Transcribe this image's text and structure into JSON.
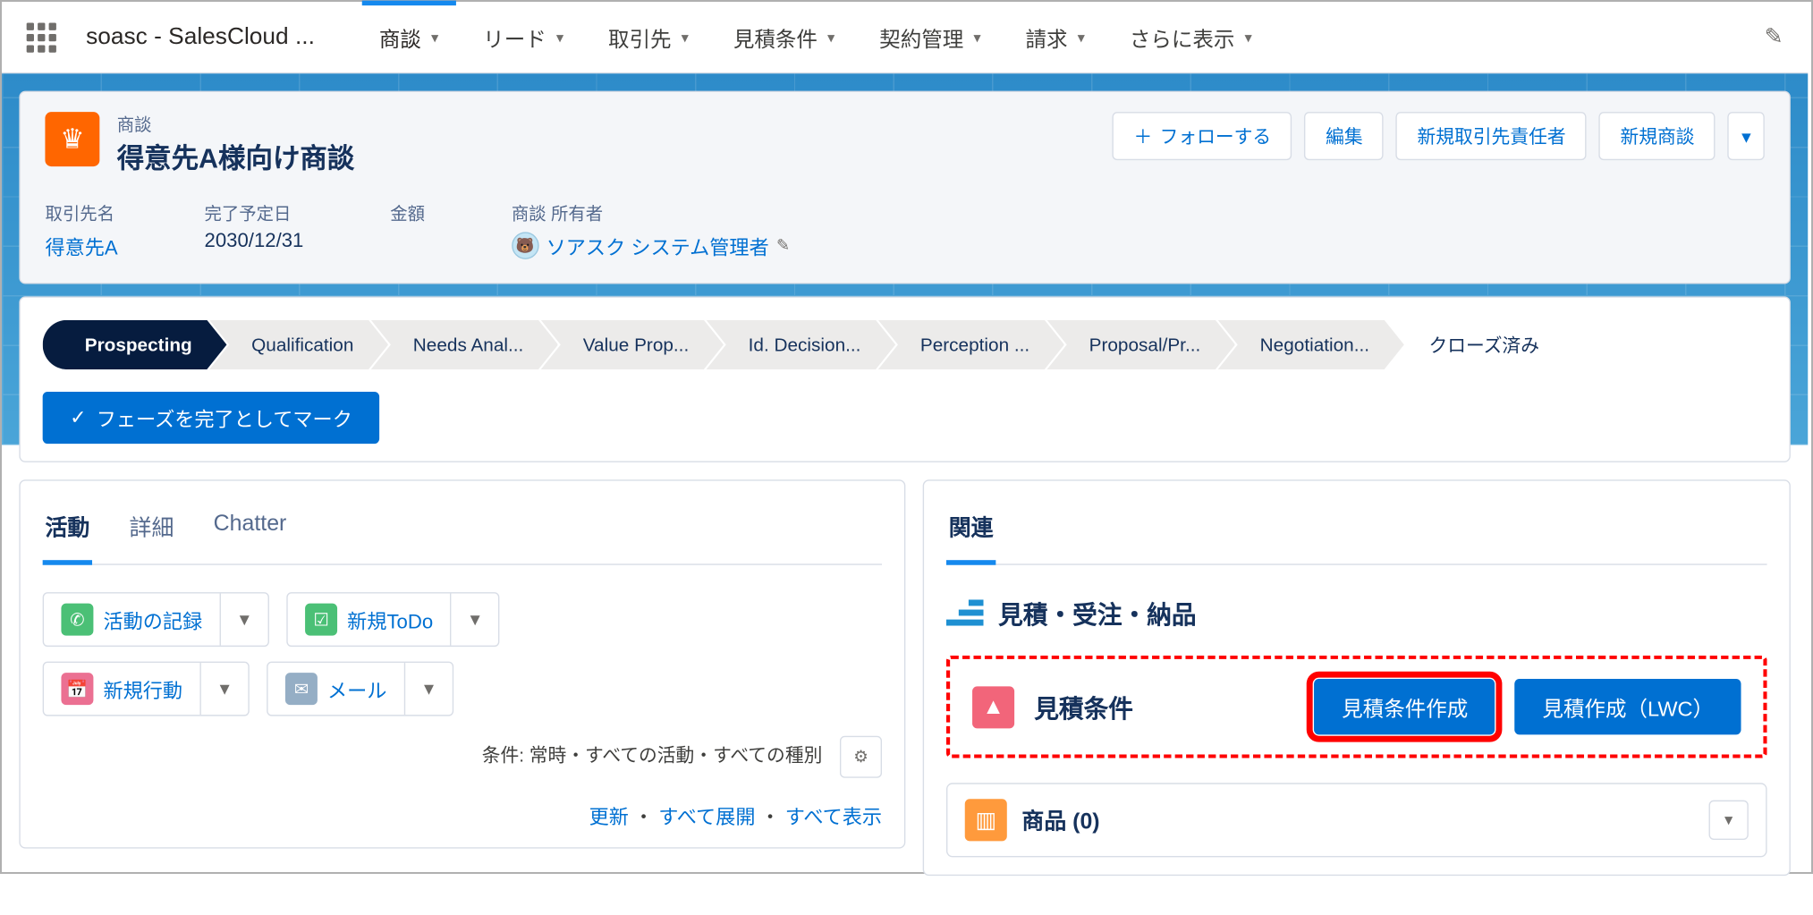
{
  "app_name": "soasc - SalesCloud ...",
  "nav": {
    "tabs": [
      "商談",
      "リード",
      "取引先",
      "見積条件",
      "契約管理",
      "請求",
      "さらに表示"
    ],
    "active_index": 0
  },
  "record": {
    "object_label": "商談",
    "title": "得意先A様向け商談",
    "actions": {
      "follow": "フォローする",
      "edit": "編集",
      "new_contact_role": "新規取引先責任者",
      "new_opp": "新規商談"
    },
    "fields": {
      "account_label": "取引先名",
      "account_value": "得意先A",
      "close_date_label": "完了予定日",
      "close_date_value": "2030/12/31",
      "amount_label": "金額",
      "amount_value": "",
      "owner_label": "商談 所有者",
      "owner_value": "ソアスク システム管理者"
    }
  },
  "path": {
    "stages": [
      "Prospecting",
      "Qualification",
      "Needs Anal...",
      "Value Prop...",
      "Id. Decision...",
      "Perception ...",
      "Proposal/Pr...",
      "Negotiation...",
      "クローズ済み"
    ],
    "current_index": 0,
    "mark_complete": "フェーズを完了としてマーク"
  },
  "left": {
    "tabs": [
      "活動",
      "詳細",
      "Chatter"
    ],
    "active_tab": 0,
    "activity_buttons": {
      "log_call": "活動の記録",
      "new_task": "新規ToDo",
      "new_event": "新規行動",
      "email": "メール"
    },
    "filter_text": "条件: 常時・すべての活動・すべての種別",
    "links": {
      "refresh": "更新",
      "expand_all": "すべて展開",
      "view_all": "すべて表示"
    }
  },
  "right": {
    "tab_label": "関連",
    "section_title": "見積・受注・納品",
    "estimate_card": {
      "title": "見積条件",
      "create_estimate_cond": "見積条件作成",
      "create_estimate_lwc": "見積作成（LWC）"
    },
    "products": {
      "title": "商品 (0)"
    }
  }
}
